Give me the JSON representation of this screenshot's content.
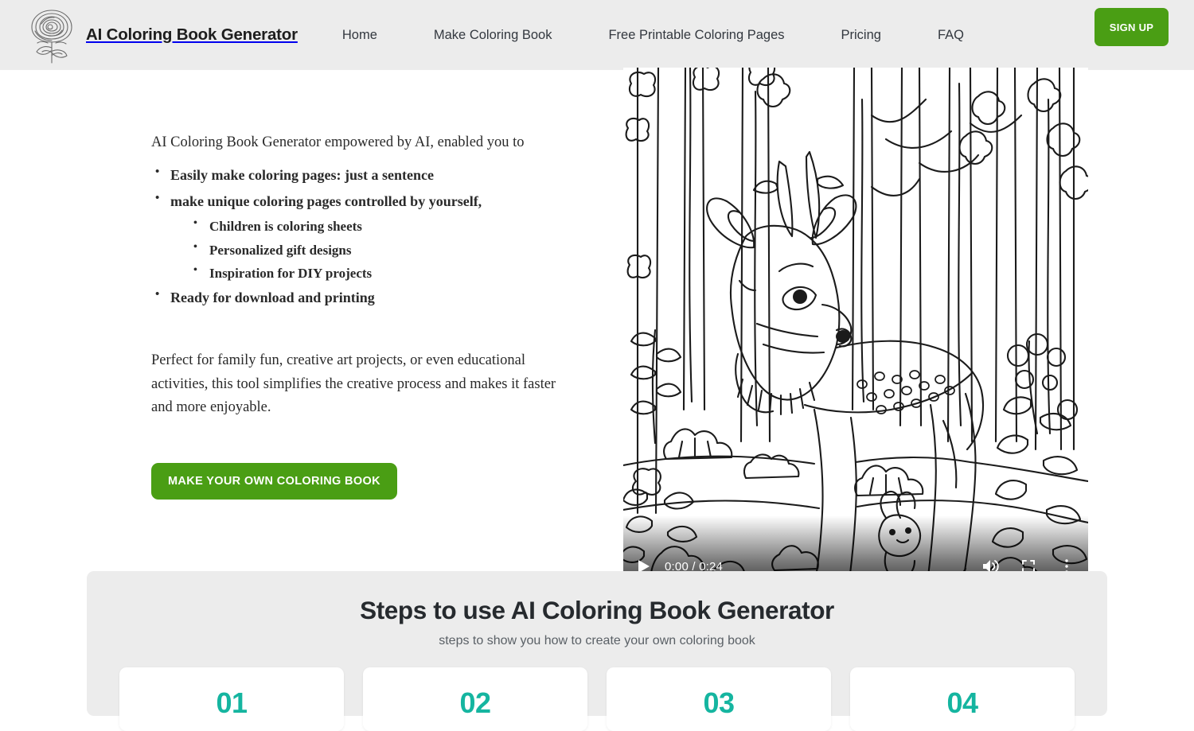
{
  "header": {
    "brand_name": "AI Coloring Book Generator",
    "logo_icon": "rose-line-art-logo",
    "nav": [
      {
        "label": "Home"
      },
      {
        "label": "Make Coloring Book"
      },
      {
        "label": "Free Printable Coloring Pages"
      },
      {
        "label": "Pricing"
      },
      {
        "label": "FAQ"
      }
    ],
    "signup_label": "SIGN UP",
    "background_color": "#ececec",
    "accent_green": "#4a9e14"
  },
  "hero": {
    "intro": "AI Coloring Book Generator empowered by AI, enabled you to",
    "bullets": [
      {
        "text": "Easily make coloring pages: just a sentence",
        "children": []
      },
      {
        "text": "make unique coloring pages controlled by yourself,",
        "children": [
          "Children is coloring sheets",
          "Personalized gift designs",
          "Inspiration for DIY projects"
        ]
      },
      {
        "text": "Ready for download and printing",
        "children": []
      }
    ],
    "paragraph": "Perfect for family fun, creative art projects, or even educational activities, this tool simplifies the creative process and makes it faster and more enjoyable.",
    "cta_label": "MAKE YOUR OWN COLORING BOOK"
  },
  "video": {
    "poster_description": "Black and white line-art coloring page of a spotted deer fawn standing in a forest with tall trees, ferns, berries and a small rabbit",
    "current_time": "0:00",
    "duration": "0:24",
    "time_display": "0:00 / 0:24",
    "play_icon": "play-icon",
    "volume_icon": "volume-icon",
    "fullscreen_icon": "fullscreen-icon",
    "more_icon": "more-options-icon",
    "buffered_percent": 19
  },
  "steps": {
    "title": "Steps to use AI Coloring Book Generator",
    "subtitle": "steps to show you how to create your own coloring book",
    "accent_color": "#15b5a0",
    "cards": [
      {
        "number": "01"
      },
      {
        "number": "02"
      },
      {
        "number": "03"
      },
      {
        "number": "04"
      }
    ]
  }
}
